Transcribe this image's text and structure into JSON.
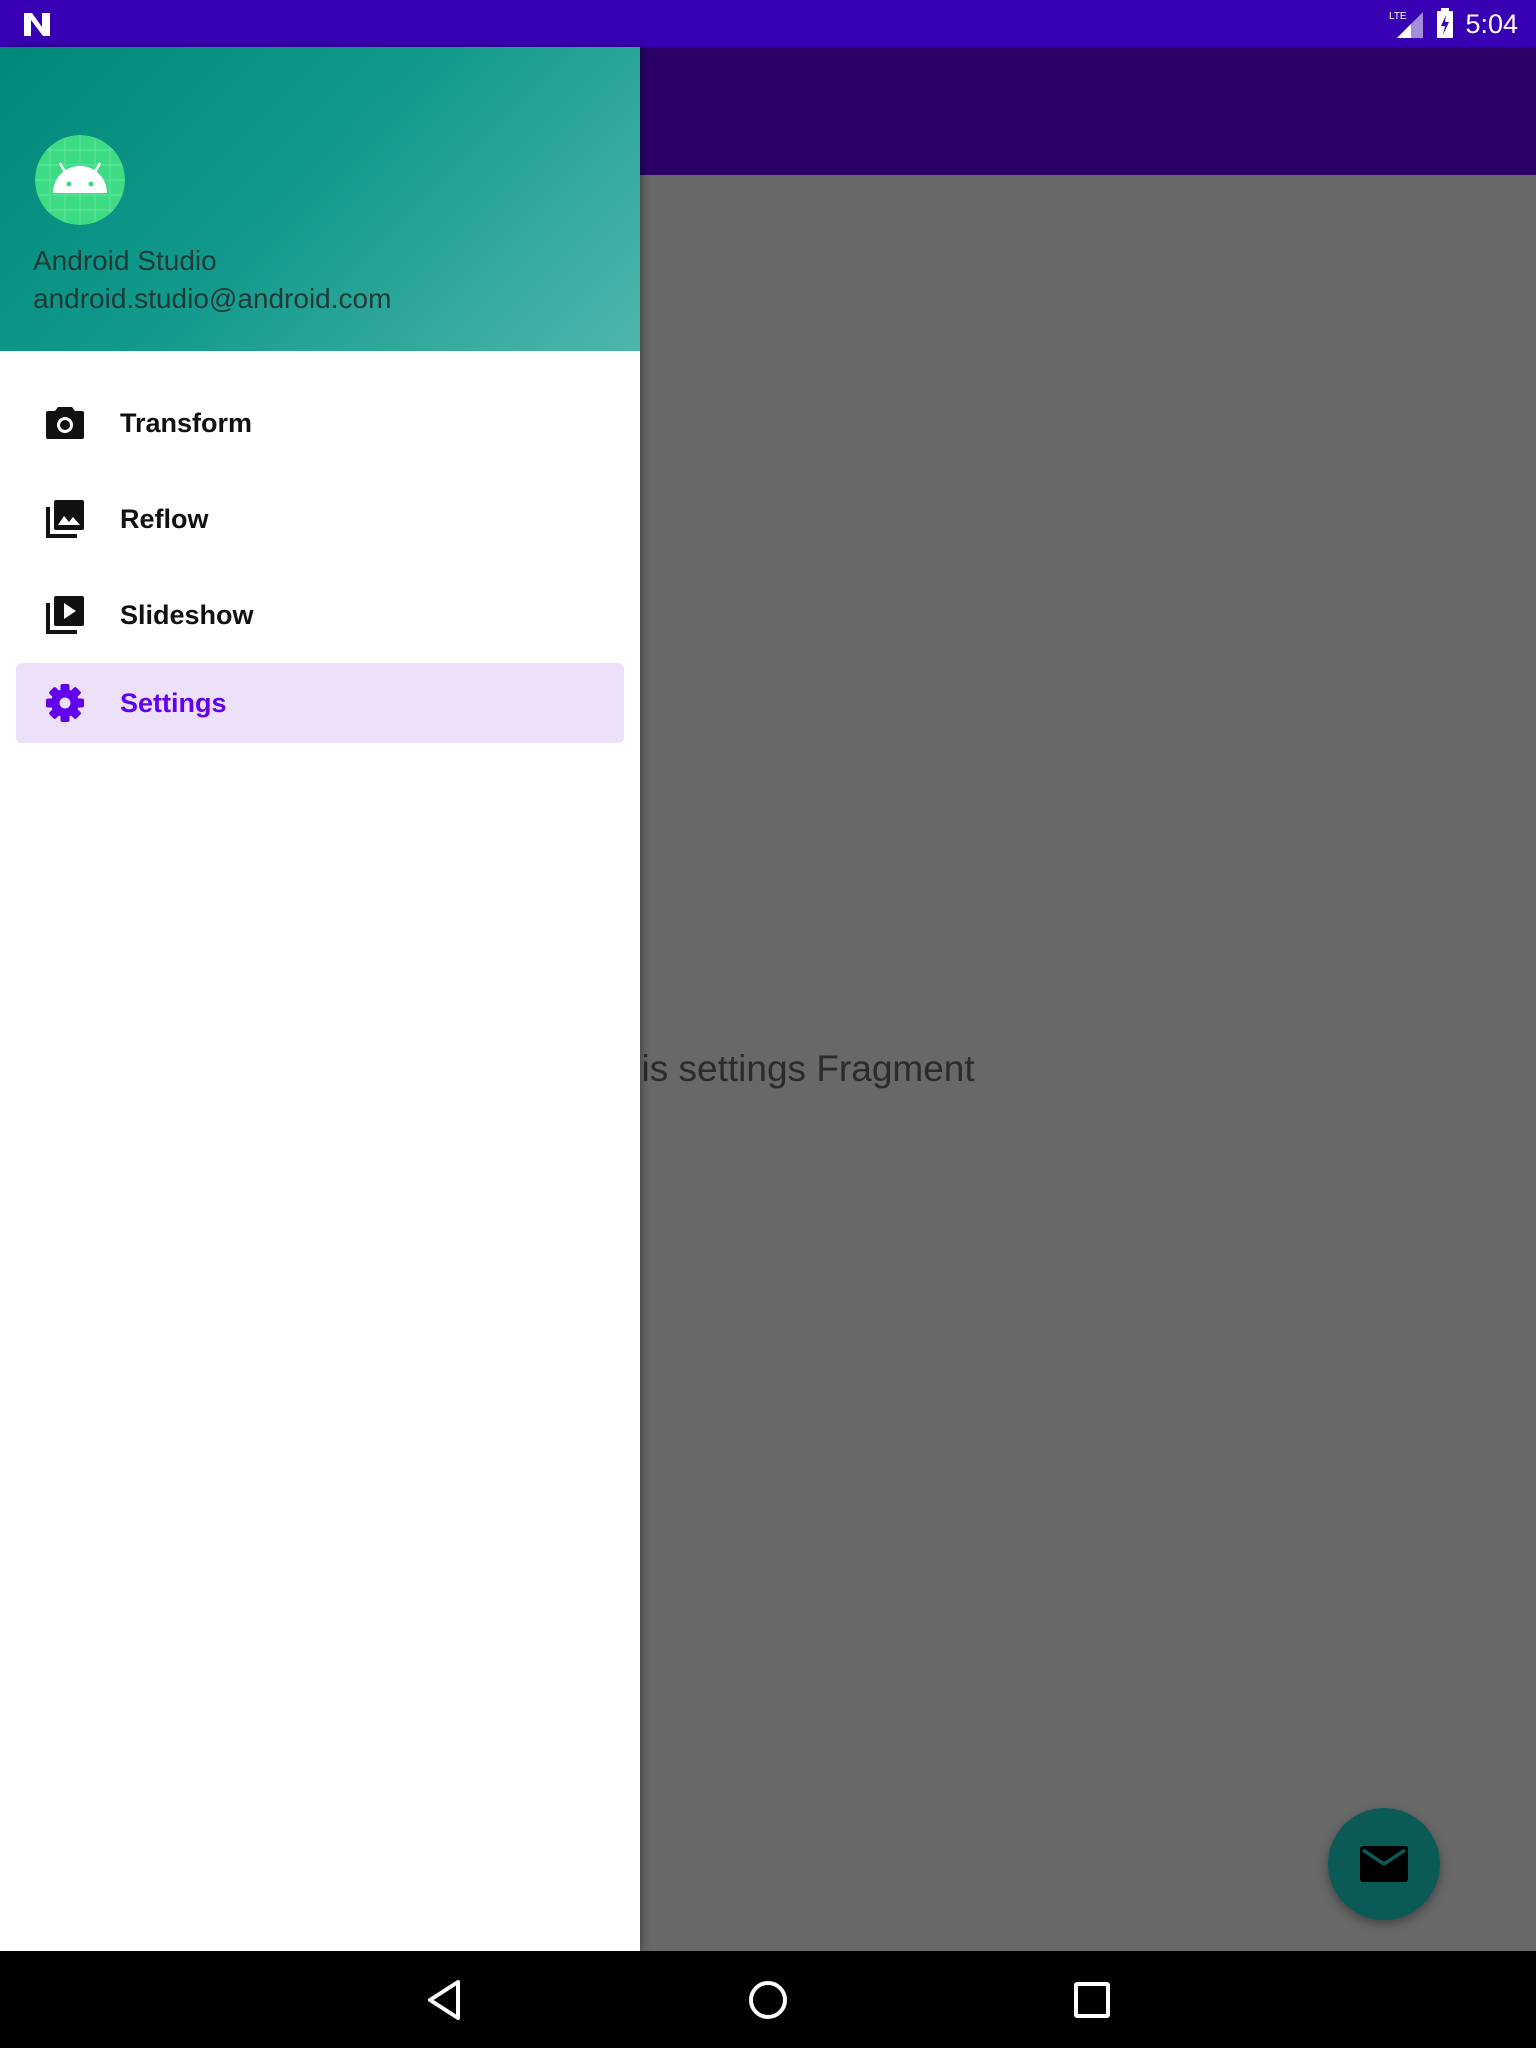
{
  "status_bar": {
    "time": "5:04",
    "network": "LTE"
  },
  "content": {
    "fragment_text": "This is settings Fragment"
  },
  "drawer": {
    "header": {
      "name": "Android Studio",
      "email": "android.studio@android.com"
    },
    "items": [
      {
        "label": "Transform",
        "icon": "camera-icon",
        "selected": false
      },
      {
        "label": "Reflow",
        "icon": "photo-library-icon",
        "selected": false
      },
      {
        "label": "Slideshow",
        "icon": "video-library-icon",
        "selected": false
      },
      {
        "label": "Settings",
        "icon": "gear-icon",
        "selected": true
      }
    ]
  },
  "fab": {
    "icon": "mail-icon"
  },
  "nav_bar": {
    "buttons": [
      "back-icon",
      "home-icon",
      "recents-icon"
    ]
  },
  "colors": {
    "status_bar": "#3700b3",
    "app_bar": "#2a0066",
    "accent": "#6200ee",
    "selected_bg": "#ede0fb",
    "header_teal": "#00897b",
    "fab": "#0a5a55"
  }
}
